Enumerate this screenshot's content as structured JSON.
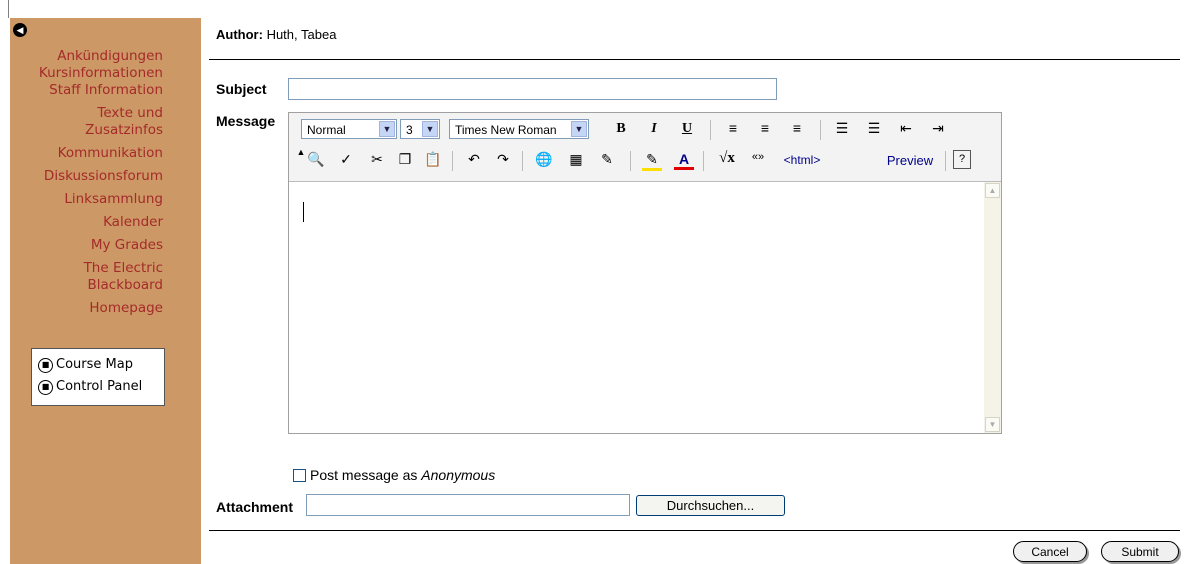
{
  "sidebar": {
    "nav_items": [
      "Ankündigungen",
      "Kursinformationen",
      "Staff Information",
      "Texte und",
      "Zusatzinfos",
      "Kommunikation",
      "Diskussionsforum",
      "Linksammlung",
      "Kalender",
      "My Grades",
      "The Electric",
      "Blackboard",
      "Homepage"
    ],
    "tools": {
      "course_map": "Course Map",
      "control_panel": "Control Panel"
    }
  },
  "form": {
    "author_label": "Author:",
    "author_value": "Huth, Tabea",
    "subject_label": "Subject",
    "subject_value": "",
    "message_label": "Message",
    "anonymous_label": "Post message as",
    "anonymous_word": "Anonymous",
    "attachment_label": "Attachment",
    "attachment_value": "",
    "browse_button": "Durchsuchen...",
    "cancel_button": "Cancel",
    "submit_button": "Submit"
  },
  "editor": {
    "paragraph_style": "Normal",
    "font_size": "3",
    "font_face": "Times New Roman",
    "html_label": "<html>",
    "preview_label": "Preview"
  }
}
